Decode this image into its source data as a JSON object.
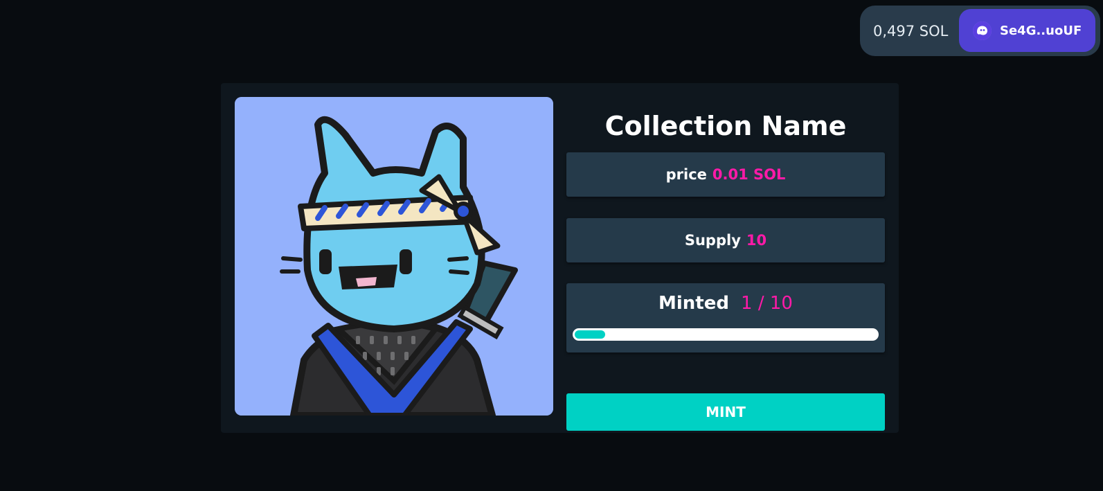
{
  "wallet": {
    "balance": "0,497 SOL",
    "address": "Se4G..uoUF",
    "icon": "phantom-ghost-icon"
  },
  "collection": {
    "name": "Collection Name",
    "image_alt": "Blue ninja cat NFT"
  },
  "stats": {
    "price_label": "price",
    "price_value": "0.01 SOL",
    "supply_label": "Supply",
    "supply_value": "10",
    "minted_label": "Minted",
    "minted_value": "1 / 10",
    "minted_progress": 0.1
  },
  "mint_button": "MINT",
  "colors": {
    "accent": "#ff1aa8",
    "mint": "#00d1c4",
    "wallet": "#5041d3",
    "panel": "#253a4a",
    "background": "#080c10"
  }
}
